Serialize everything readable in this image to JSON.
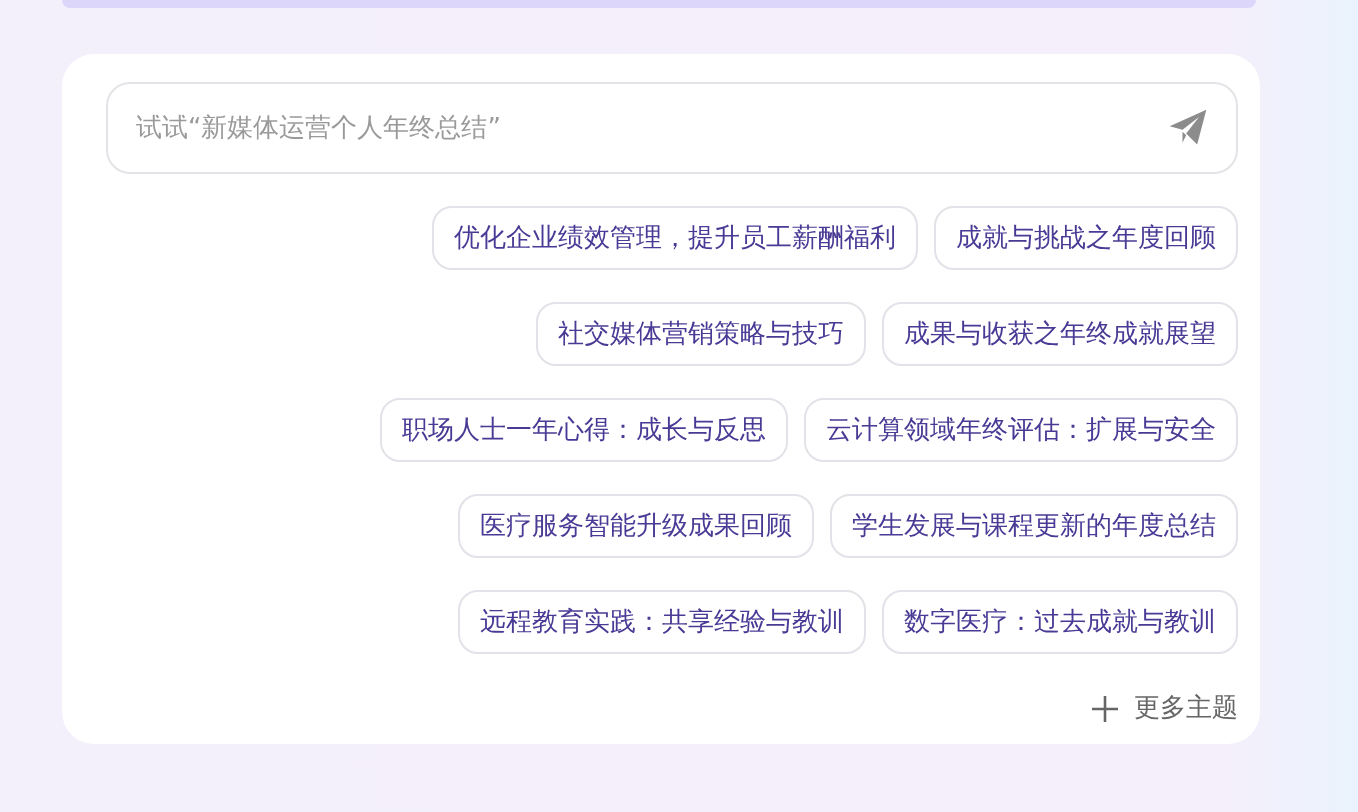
{
  "search": {
    "placeholder": "试试“新媒体运营个人年终总结”"
  },
  "topic_rows": [
    [
      "优化企业绩效管理，提升员工薪酬福利",
      "成就与挑战之年度回顾"
    ],
    [
      "社交媒体营销策略与技巧",
      "成果与收获之年终成就展望"
    ],
    [
      "职场人士一年心得：成长与反思",
      "云计算领域年终评估：扩展与安全"
    ],
    [
      "医疗服务智能升级成果回顾",
      "学生发展与课程更新的年度总结"
    ],
    [
      "远程教育实践：共享经验与教训",
      "数字医疗：过去成就与教训"
    ]
  ],
  "more_link": "更多主题"
}
